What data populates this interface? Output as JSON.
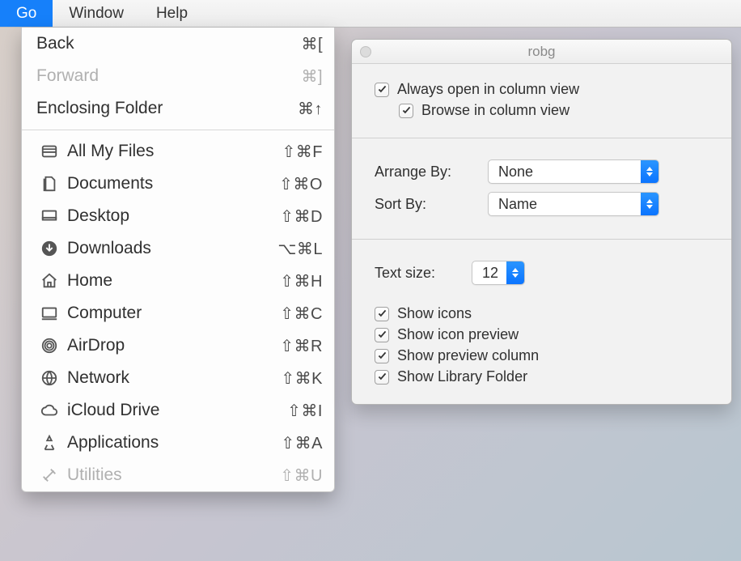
{
  "menubar": {
    "go": "Go",
    "window": "Window",
    "help": "Help"
  },
  "go_menu": {
    "back": {
      "label": "Back",
      "shortcut": "⌘["
    },
    "forward": {
      "label": "Forward",
      "shortcut": "⌘]"
    },
    "enclosing": {
      "label": "Enclosing Folder",
      "shortcut": "⌘↑"
    },
    "all_my_files": {
      "label": "All My Files",
      "shortcut": "⇧⌘F"
    },
    "documents": {
      "label": "Documents",
      "shortcut": "⇧⌘O"
    },
    "desktop": {
      "label": "Desktop",
      "shortcut": "⇧⌘D"
    },
    "downloads": {
      "label": "Downloads",
      "shortcut": "⌥⌘L"
    },
    "home": {
      "label": "Home",
      "shortcut": "⇧⌘H"
    },
    "computer": {
      "label": "Computer",
      "shortcut": "⇧⌘C"
    },
    "airdrop": {
      "label": "AirDrop",
      "shortcut": "⇧⌘R"
    },
    "network": {
      "label": "Network",
      "shortcut": "⇧⌘K"
    },
    "icloud": {
      "label": "iCloud Drive",
      "shortcut": "⇧⌘I"
    },
    "applications": {
      "label": "Applications",
      "shortcut": "⇧⌘A"
    },
    "utilities": {
      "label": "Utilities",
      "shortcut": "⇧⌘U"
    }
  },
  "panel": {
    "title": "robg",
    "always_open": "Always open in column view",
    "browse": "Browse in column view",
    "arrange_label": "Arrange By:",
    "arrange_value": "None",
    "sort_label": "Sort By:",
    "sort_value": "Name",
    "textsize_label": "Text size:",
    "textsize_value": "12",
    "show_icons": "Show icons",
    "show_icon_preview": "Show icon preview",
    "show_preview_col": "Show preview column",
    "show_library": "Show Library Folder"
  }
}
